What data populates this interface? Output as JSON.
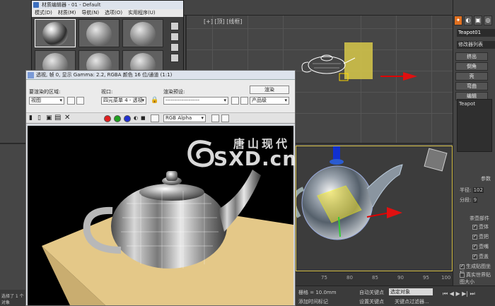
{
  "top_viewport": {
    "label": "[+] [顶] [线框]"
  },
  "material_editor": {
    "title": "材质编辑器 - 01 - Default",
    "menu": [
      "模式(D)",
      "材质(M)",
      "导航(N)",
      "选项(O)",
      "实用程序(U)"
    ]
  },
  "render_frame": {
    "title": "透视, 帧 0, 显示 Gamma: 2.2, RGBA 颜色 16 位/通道 (1:1)",
    "area_label": "要渲染的区域:",
    "area_value": "视图",
    "viewport_label": "视口:",
    "viewport_value": "四元菜单 4 - 透视",
    "preset_label": "渲染预设:",
    "preset_value": "-------------------",
    "render_button": "渲染",
    "mode_value": "产品级",
    "channel_value": "RGB Alpha"
  },
  "command_panel": {
    "object_name": "Teapot01",
    "modifier_list": "修改器列表",
    "buttons": [
      "挤出",
      "倒角",
      "壳",
      "弯曲",
      "编辑"
    ],
    "stack_item": "Teapot",
    "params_title": "参数",
    "radius_label": "半径:",
    "radius_value": "102",
    "segments_label": "分段:",
    "segments_value": "9",
    "parts_title": "茶壶部件",
    "parts": [
      "壶体",
      "壶把",
      "壶嘴",
      "壶盖"
    ],
    "gen_mapping": "生成贴图坐标",
    "real_world": "真实世界贴图大小"
  },
  "bottom": {
    "grid_label": "栅格 = 10.0mm",
    "auto_key": "自动关键点",
    "selected_obj": "选定对象",
    "set_key": "设置关键点",
    "key_filter": "关键点过滤器...",
    "add_time_tag": "添加时间标记",
    "ticks": [
      "75",
      "80",
      "85",
      "90",
      "95",
      "100"
    ],
    "status": "选择了 1 个对象"
  },
  "watermark": {
    "cn": "唐山现代",
    "en": "SXD.cn"
  }
}
